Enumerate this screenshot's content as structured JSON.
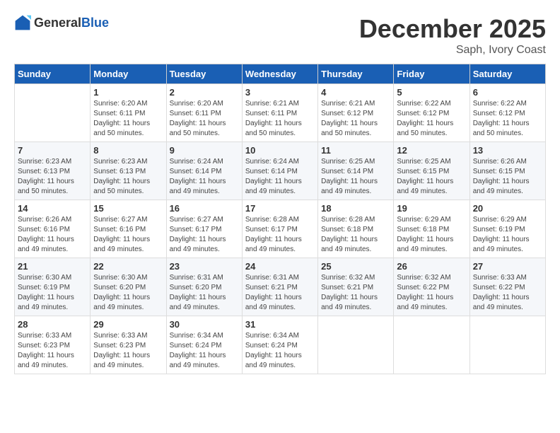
{
  "header": {
    "logo": {
      "general": "General",
      "blue": "Blue"
    },
    "month": "December 2025",
    "location": "Saph, Ivory Coast"
  },
  "weekdays": [
    "Sunday",
    "Monday",
    "Tuesday",
    "Wednesday",
    "Thursday",
    "Friday",
    "Saturday"
  ],
  "weeks": [
    [
      {
        "day": "",
        "sunrise": "",
        "sunset": "",
        "daylight": ""
      },
      {
        "day": "1",
        "sunrise": "Sunrise: 6:20 AM",
        "sunset": "Sunset: 6:11 PM",
        "daylight": "Daylight: 11 hours and 50 minutes."
      },
      {
        "day": "2",
        "sunrise": "Sunrise: 6:20 AM",
        "sunset": "Sunset: 6:11 PM",
        "daylight": "Daylight: 11 hours and 50 minutes."
      },
      {
        "day": "3",
        "sunrise": "Sunrise: 6:21 AM",
        "sunset": "Sunset: 6:11 PM",
        "daylight": "Daylight: 11 hours and 50 minutes."
      },
      {
        "day": "4",
        "sunrise": "Sunrise: 6:21 AM",
        "sunset": "Sunset: 6:12 PM",
        "daylight": "Daylight: 11 hours and 50 minutes."
      },
      {
        "day": "5",
        "sunrise": "Sunrise: 6:22 AM",
        "sunset": "Sunset: 6:12 PM",
        "daylight": "Daylight: 11 hours and 50 minutes."
      },
      {
        "day": "6",
        "sunrise": "Sunrise: 6:22 AM",
        "sunset": "Sunset: 6:12 PM",
        "daylight": "Daylight: 11 hours and 50 minutes."
      }
    ],
    [
      {
        "day": "7",
        "sunrise": "Sunrise: 6:23 AM",
        "sunset": "Sunset: 6:13 PM",
        "daylight": "Daylight: 11 hours and 50 minutes."
      },
      {
        "day": "8",
        "sunrise": "Sunrise: 6:23 AM",
        "sunset": "Sunset: 6:13 PM",
        "daylight": "Daylight: 11 hours and 50 minutes."
      },
      {
        "day": "9",
        "sunrise": "Sunrise: 6:24 AM",
        "sunset": "Sunset: 6:14 PM",
        "daylight": "Daylight: 11 hours and 49 minutes."
      },
      {
        "day": "10",
        "sunrise": "Sunrise: 6:24 AM",
        "sunset": "Sunset: 6:14 PM",
        "daylight": "Daylight: 11 hours and 49 minutes."
      },
      {
        "day": "11",
        "sunrise": "Sunrise: 6:25 AM",
        "sunset": "Sunset: 6:14 PM",
        "daylight": "Daylight: 11 hours and 49 minutes."
      },
      {
        "day": "12",
        "sunrise": "Sunrise: 6:25 AM",
        "sunset": "Sunset: 6:15 PM",
        "daylight": "Daylight: 11 hours and 49 minutes."
      },
      {
        "day": "13",
        "sunrise": "Sunrise: 6:26 AM",
        "sunset": "Sunset: 6:15 PM",
        "daylight": "Daylight: 11 hours and 49 minutes."
      }
    ],
    [
      {
        "day": "14",
        "sunrise": "Sunrise: 6:26 AM",
        "sunset": "Sunset: 6:16 PM",
        "daylight": "Daylight: 11 hours and 49 minutes."
      },
      {
        "day": "15",
        "sunrise": "Sunrise: 6:27 AM",
        "sunset": "Sunset: 6:16 PM",
        "daylight": "Daylight: 11 hours and 49 minutes."
      },
      {
        "day": "16",
        "sunrise": "Sunrise: 6:27 AM",
        "sunset": "Sunset: 6:17 PM",
        "daylight": "Daylight: 11 hours and 49 minutes."
      },
      {
        "day": "17",
        "sunrise": "Sunrise: 6:28 AM",
        "sunset": "Sunset: 6:17 PM",
        "daylight": "Daylight: 11 hours and 49 minutes."
      },
      {
        "day": "18",
        "sunrise": "Sunrise: 6:28 AM",
        "sunset": "Sunset: 6:18 PM",
        "daylight": "Daylight: 11 hours and 49 minutes."
      },
      {
        "day": "19",
        "sunrise": "Sunrise: 6:29 AM",
        "sunset": "Sunset: 6:18 PM",
        "daylight": "Daylight: 11 hours and 49 minutes."
      },
      {
        "day": "20",
        "sunrise": "Sunrise: 6:29 AM",
        "sunset": "Sunset: 6:19 PM",
        "daylight": "Daylight: 11 hours and 49 minutes."
      }
    ],
    [
      {
        "day": "21",
        "sunrise": "Sunrise: 6:30 AM",
        "sunset": "Sunset: 6:19 PM",
        "daylight": "Daylight: 11 hours and 49 minutes."
      },
      {
        "day": "22",
        "sunrise": "Sunrise: 6:30 AM",
        "sunset": "Sunset: 6:20 PM",
        "daylight": "Daylight: 11 hours and 49 minutes."
      },
      {
        "day": "23",
        "sunrise": "Sunrise: 6:31 AM",
        "sunset": "Sunset: 6:20 PM",
        "daylight": "Daylight: 11 hours and 49 minutes."
      },
      {
        "day": "24",
        "sunrise": "Sunrise: 6:31 AM",
        "sunset": "Sunset: 6:21 PM",
        "daylight": "Daylight: 11 hours and 49 minutes."
      },
      {
        "day": "25",
        "sunrise": "Sunrise: 6:32 AM",
        "sunset": "Sunset: 6:21 PM",
        "daylight": "Daylight: 11 hours and 49 minutes."
      },
      {
        "day": "26",
        "sunrise": "Sunrise: 6:32 AM",
        "sunset": "Sunset: 6:22 PM",
        "daylight": "Daylight: 11 hours and 49 minutes."
      },
      {
        "day": "27",
        "sunrise": "Sunrise: 6:33 AM",
        "sunset": "Sunset: 6:22 PM",
        "daylight": "Daylight: 11 hours and 49 minutes."
      }
    ],
    [
      {
        "day": "28",
        "sunrise": "Sunrise: 6:33 AM",
        "sunset": "Sunset: 6:23 PM",
        "daylight": "Daylight: 11 hours and 49 minutes."
      },
      {
        "day": "29",
        "sunrise": "Sunrise: 6:33 AM",
        "sunset": "Sunset: 6:23 PM",
        "daylight": "Daylight: 11 hours and 49 minutes."
      },
      {
        "day": "30",
        "sunrise": "Sunrise: 6:34 AM",
        "sunset": "Sunset: 6:24 PM",
        "daylight": "Daylight: 11 hours and 49 minutes."
      },
      {
        "day": "31",
        "sunrise": "Sunrise: 6:34 AM",
        "sunset": "Sunset: 6:24 PM",
        "daylight": "Daylight: 11 hours and 49 minutes."
      },
      {
        "day": "",
        "sunrise": "",
        "sunset": "",
        "daylight": ""
      },
      {
        "day": "",
        "sunrise": "",
        "sunset": "",
        "daylight": ""
      },
      {
        "day": "",
        "sunrise": "",
        "sunset": "",
        "daylight": ""
      }
    ]
  ]
}
